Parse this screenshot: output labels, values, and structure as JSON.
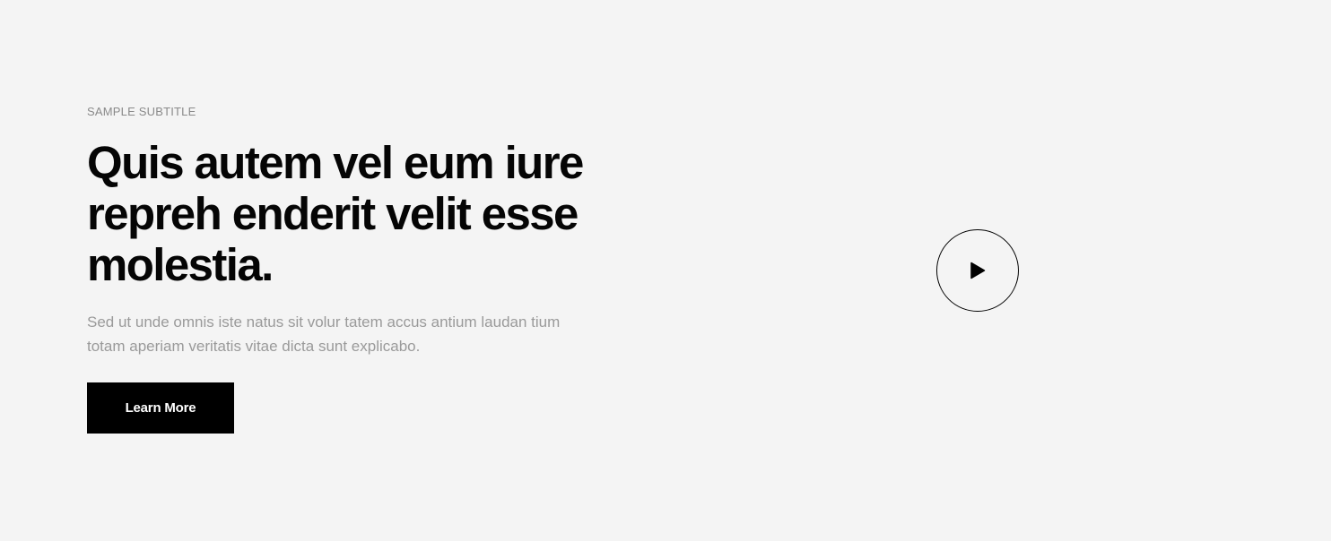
{
  "hero": {
    "subtitle": "SAMPLE SUBTITLE",
    "title": "Quis autem vel eum iure repreh enderit velit esse molestia.",
    "description": "Sed ut unde omnis iste natus sit volur tatem accus antium laudan tium totam aperiam veritatis vitae dicta sunt explicabo.",
    "cta_label": "Learn More",
    "play_icon": "play-icon"
  },
  "colors": {
    "background": "#f4f4f4",
    "title": "#050505",
    "muted_text": "#9a9a9a",
    "button_bg": "#000000",
    "button_text": "#ffffff"
  }
}
